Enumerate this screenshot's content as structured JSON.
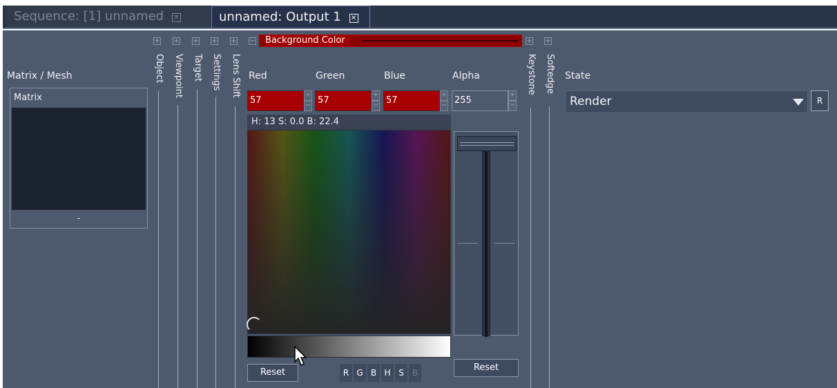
{
  "tabs": [
    {
      "label": "Sequence: [1] unnamed",
      "active": false
    },
    {
      "label": "unnamed: Output 1",
      "active": true
    }
  ],
  "matrix": {
    "label": "Matrix / Mesh",
    "items": [
      "Matrix"
    ],
    "footer": "-"
  },
  "sections": {
    "object": "Object",
    "viewpoint": "Viewpoint",
    "target": "Target",
    "settings": "Settings",
    "lens_shift": "Lens Shift",
    "keystone": "Keystone",
    "softedge": "Softedge"
  },
  "expand_glyph": "+",
  "collapse_glyph": "−",
  "background_color": {
    "title": "Background Color",
    "red_label": "Red",
    "green_label": "Green",
    "blue_label": "Blue",
    "alpha_label": "Alpha",
    "red": "57",
    "green": "57",
    "blue": "57",
    "alpha": "255",
    "hsb_text": "H: 13  S: 0.0  B: 22.4",
    "reset_label": "Reset",
    "alpha_reset_label": "Reset",
    "modes": [
      "R",
      "G",
      "B",
      "H",
      "S",
      "B"
    ],
    "alpha_level": 1.0
  },
  "state": {
    "label": "State",
    "value": "Render",
    "r_button": "R"
  },
  "colors": {
    "field_red": "#a80000",
    "panel_bg": "#4d596d",
    "tab_bar": "#2b3548"
  }
}
